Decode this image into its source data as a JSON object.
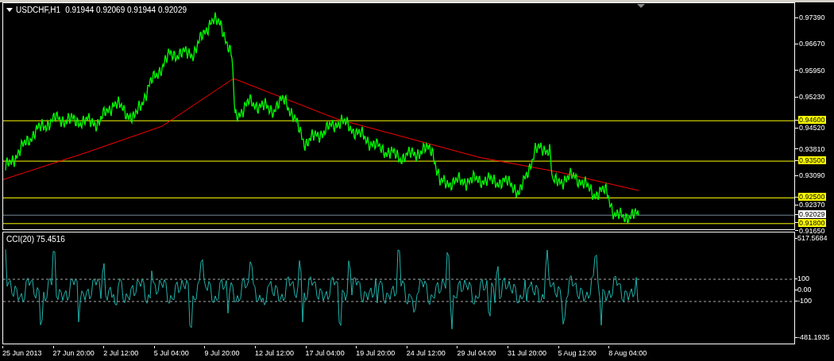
{
  "chart": {
    "symbol_caption": "USDCHF,H1",
    "ohlc": "0.91944 0.92069 0.91944 0.92029"
  },
  "price_ticks": [
    "0.97390",
    "0.96670",
    "0.95950",
    "0.95230",
    "0.94520",
    "0.93810",
    "0.93090",
    "0.92370",
    "0.91650"
  ],
  "price_lines": [
    {
      "kind": "level",
      "price": "0.94600"
    },
    {
      "kind": "level",
      "price": "0.93500"
    },
    {
      "kind": "level",
      "price": "0.92500"
    },
    {
      "kind": "bid",
      "price": "0.92029"
    },
    {
      "kind": "level",
      "price": "0.91800"
    }
  ],
  "indicator": {
    "caption": "CCI(20) 75.4516",
    "ticks": [
      "517.5684",
      "100",
      "0.00",
      "-100",
      "-481.1935"
    ]
  },
  "time_axis": [
    "25 Jun 2013",
    "27 Jun 20:00",
    "2 Jul 12:00",
    "5 Jul 04:00",
    "9 Jul 20:00",
    "12 Jul 12:00",
    "17 Jul 04:00",
    "19 Jul 20:00",
    "24 Jul 12:00",
    "29 Jul 04:00",
    "31 Jul 20:00",
    "5 Aug 12:00",
    "8 Aug 04:00"
  ]
}
